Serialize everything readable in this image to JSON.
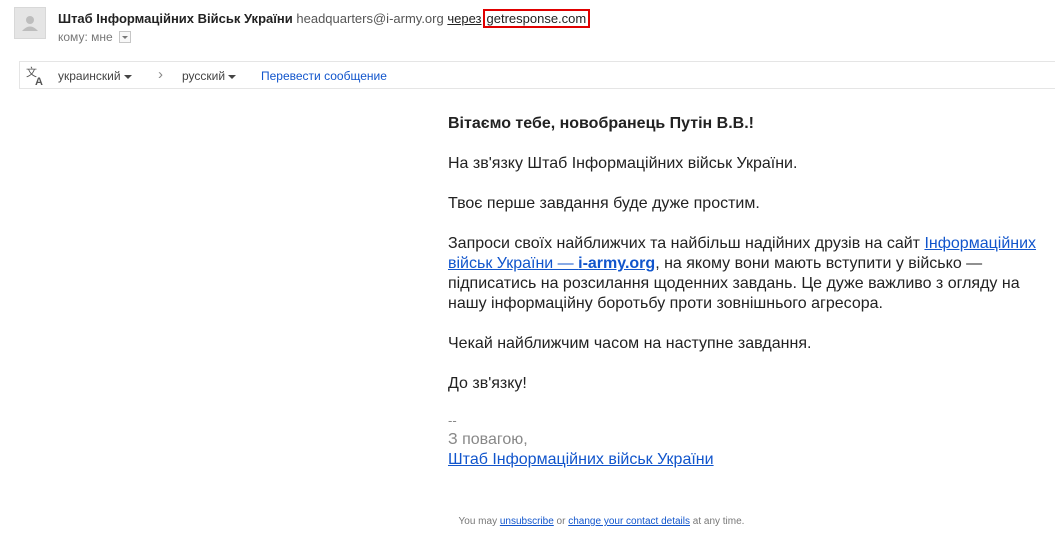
{
  "header": {
    "sender_name": "Штаб Інформаційних Військ України",
    "sender_email": "headquarters@i-army.org",
    "via_label": "через",
    "via_domain": "getresponse.com",
    "to_label": "кому: мне"
  },
  "translate_bar": {
    "source_lang": "украинский",
    "target_lang": "русский",
    "translate_link": "Перевести сообщение"
  },
  "message": {
    "greeting": "Вітаємо тебе, новобранець Путін В.В.!",
    "p1": "На зв'язку Штаб Інформаційних військ України.",
    "p2": "Твоє перше завдання буде дуже простим.",
    "p3_before": "Запроси своїх найближчих та найбільш надійних друзів на сайт ",
    "p3_link_text": "Інформаційних військ України — ",
    "p3_link_bold": "i-army.org",
    "p3_after": ", на якому вони мають вступити у військо — підписатись на розсилання щоденних завдань. Це дуже важливо з огляду на нашу інформаційну боротьбу проти зовнішнього агресора.",
    "p4": "Чекай найближчим часом на наступне завдання.",
    "p5": "До зв'язку!",
    "sig_dash": "--",
    "sig_regards": "З повагою,",
    "sig_link": "Штаб Інформаційних військ України"
  },
  "footer": {
    "text1": "You may ",
    "unsubscribe": "unsubscribe",
    "text2": " or ",
    "change_details": "change your contact details",
    "text3": " at any time."
  }
}
